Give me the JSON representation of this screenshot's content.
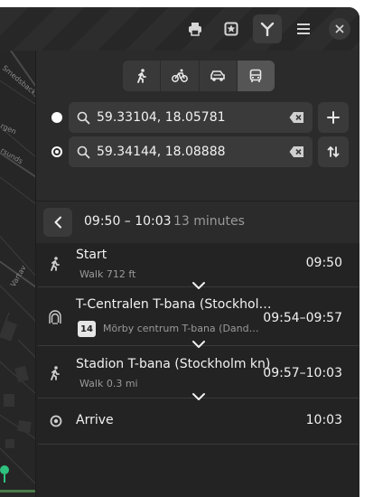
{
  "header": {
    "buttons": [
      {
        "icon": "printer-icon"
      },
      {
        "icon": "bookmark-star-icon"
      },
      {
        "icon": "route-icon"
      },
      {
        "icon": "hamburger-menu-icon"
      }
    ],
    "close_icon": "close-icon"
  },
  "map": {
    "street_labels": [
      "Smedsbacks",
      "rgen",
      "rsunds",
      "Vartav"
    ]
  },
  "transport_modes": [
    {
      "name": "walk",
      "icon": "pedestrian-icon",
      "selected": false
    },
    {
      "name": "bike",
      "icon": "bicycle-icon",
      "selected": false
    },
    {
      "name": "car",
      "icon": "car-icon",
      "selected": false
    },
    {
      "name": "transit",
      "icon": "bus-icon",
      "selected": true
    }
  ],
  "origin": {
    "value": "59.33104, 18.05781"
  },
  "destination": {
    "value": "59.34144, 18.08888"
  },
  "summary": {
    "time_range": "09:50 – 10:03",
    "duration": "13 minutes"
  },
  "legs": [
    {
      "title": "Start",
      "subtitle": "Walk 712 ft",
      "time": "09:50",
      "icon": "pedestrian-icon"
    },
    {
      "title": "T-Centralen T-bana (Stockhol…",
      "badge": "14",
      "subtitle": "Mörby centrum T-bana (Dand…",
      "time": "09:54–09:57",
      "icon": "subway-icon"
    },
    {
      "title": "Stadion T-bana (Stockholm kn)",
      "subtitle": "Walk 0.3 mi",
      "time": "09:57–10:03",
      "icon": "pedestrian-icon"
    },
    {
      "title": "Arrive",
      "time": "10:03",
      "icon": "destination-icon"
    }
  ],
  "colors": {
    "accent_green": "#2ec27e",
    "background": "#2b2b2b"
  }
}
